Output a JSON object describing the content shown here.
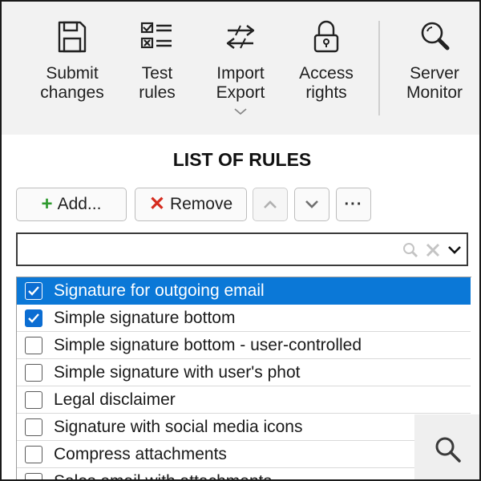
{
  "ribbon": {
    "buttons": [
      {
        "label": "Submit\nchanges",
        "icon": "floppy-disk-icon"
      },
      {
        "label": "Test\nrules",
        "icon": "checklist-icon"
      },
      {
        "label": "Import\nExport",
        "icon": "import-export-arrows-icon",
        "has_dropdown": true
      },
      {
        "label": "Access\nrights",
        "icon": "padlock-icon"
      },
      {
        "label": "Server\nMonitor",
        "icon": "magnifier-icon"
      }
    ]
  },
  "title": "LIST OF RULES",
  "toolbar": {
    "add_label": "Add...",
    "remove_label": "Remove",
    "more_label": "···"
  },
  "search": {
    "value": "",
    "placeholder": ""
  },
  "rules": [
    {
      "label": "Signature for outgoing email",
      "checked": true,
      "selected": true
    },
    {
      "label": "Simple signature bottom",
      "checked": true,
      "selected": false
    },
    {
      "label": "Simple signature bottom - user-controlled",
      "checked": false,
      "selected": false
    },
    {
      "label": "Simple signature with user's phot",
      "checked": false,
      "selected": false
    },
    {
      "label": "Legal disclaimer",
      "checked": false,
      "selected": false
    },
    {
      "label": "Signature with social media icons",
      "checked": false,
      "selected": false
    },
    {
      "label": "Compress attachments",
      "checked": false,
      "selected": false
    },
    {
      "label": "Sales email with attachments",
      "checked": false,
      "selected": false
    }
  ],
  "colors": {
    "accent": "#0b78d7",
    "add_plus": "#2e9a2e",
    "remove_x": "#d52b1e",
    "ribbon_bg": "#f2f2f2"
  }
}
